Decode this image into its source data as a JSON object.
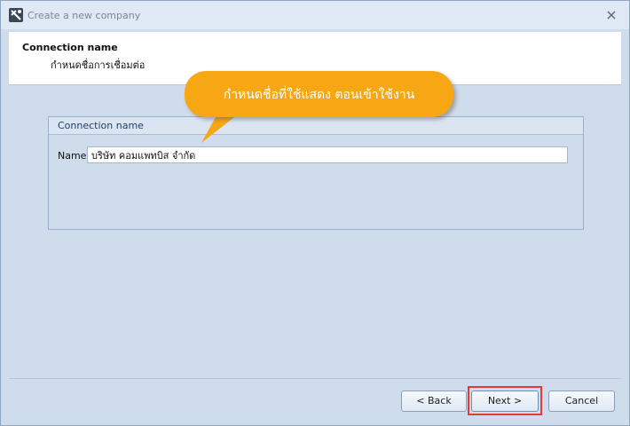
{
  "window": {
    "title": "Create a new company"
  },
  "header": {
    "title": "Connection name",
    "subtitle": "กำหนดชื่อการเชื่อมต่อ"
  },
  "group": {
    "title": "Connection name",
    "name_label": "Name",
    "name_value": "บริษัท คอมแพทบิส จำกัด"
  },
  "callout": {
    "text": "กำหนดชื่อที่ใช้แสดง ตอนเข้าใช้งาน",
    "color": "#f7a713"
  },
  "buttons": {
    "back": "< Back",
    "next": "Next >",
    "cancel": "Cancel"
  },
  "icons": {
    "app": "company-wizard-icon",
    "close": "close-icon"
  },
  "colors": {
    "background": "#cfdcec",
    "highlight": "#e23a3a"
  }
}
